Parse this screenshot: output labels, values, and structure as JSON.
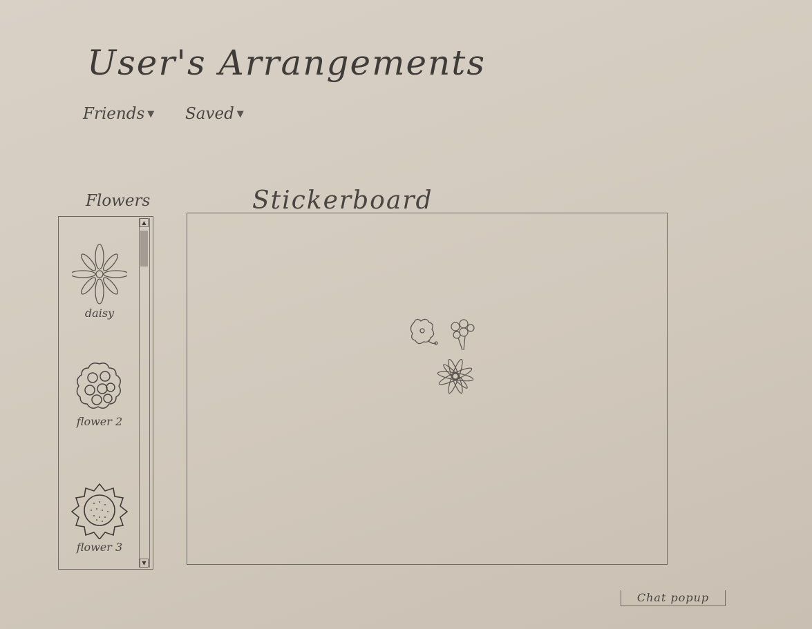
{
  "header": {
    "title": "User's Arrangements"
  },
  "nav": {
    "friends_label": "Friends",
    "saved_label": "Saved",
    "dropdown_arrow": "▼"
  },
  "flowers_panel": {
    "title": "Flowers",
    "items": [
      {
        "label": "daisy",
        "icon": "daisy-icon"
      },
      {
        "label": "flower 2",
        "icon": "rose-cluster-icon"
      },
      {
        "label": "flower 3",
        "icon": "sunflower-icon"
      }
    ],
    "scroll_up": "▲",
    "scroll_down": "▼"
  },
  "stickerboard": {
    "title": "Stickerboard",
    "stickers": [
      "small-flower-icon",
      "daisy-icon",
      "flower-cluster-icon"
    ]
  },
  "chat": {
    "label": "Chat popup"
  },
  "colors": {
    "paper": "#d2c9bd",
    "pencil": "#4a4540"
  }
}
